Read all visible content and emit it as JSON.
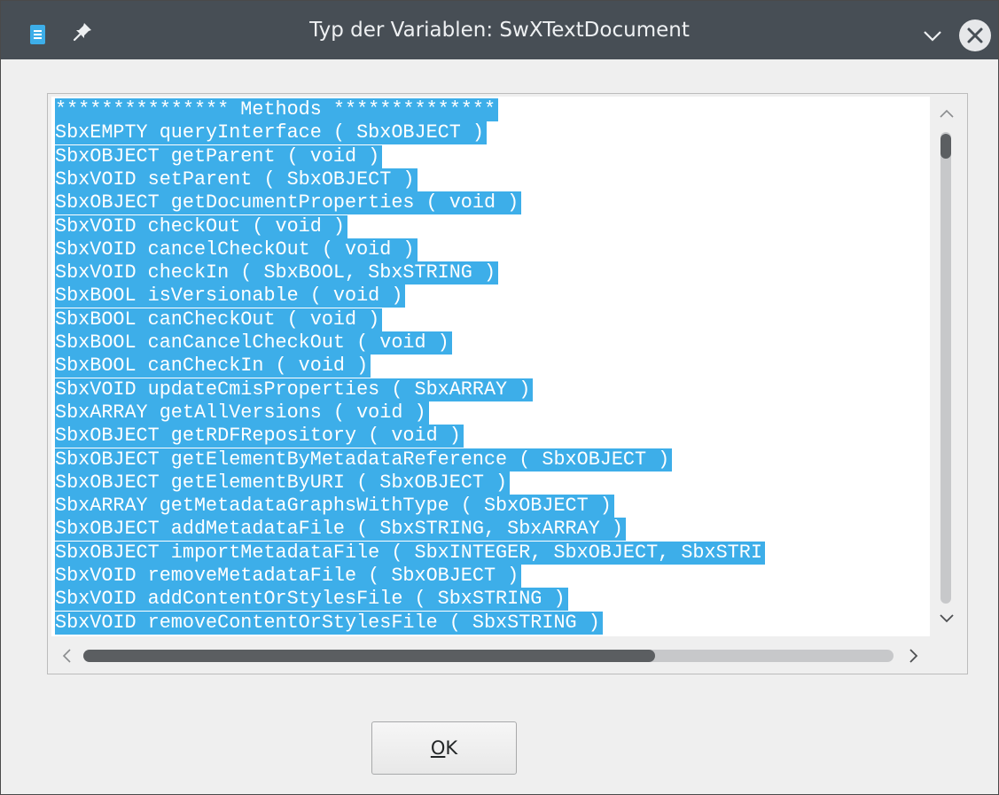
{
  "window": {
    "title": "Typ der Variablen: SwXTextDocument"
  },
  "titlebar_icons": {
    "app": "document-app-icon",
    "pin": "pin-icon",
    "minimize": "chevron-down-icon",
    "close": "close-icon"
  },
  "text_area": {
    "lines": [
      "*************** Methods **************",
      "SbxEMPTY queryInterface ( SbxOBJECT )",
      "SbxOBJECT getParent ( void )",
      "SbxVOID setParent ( SbxOBJECT )",
      "SbxOBJECT getDocumentProperties ( void )",
      "SbxVOID checkOut ( void )",
      "SbxVOID cancelCheckOut ( void )",
      "SbxVOID checkIn ( SbxBOOL, SbxSTRING )",
      "SbxBOOL isVersionable ( void )",
      "SbxBOOL canCheckOut ( void )",
      "SbxBOOL canCancelCheckOut ( void )",
      "SbxBOOL canCheckIn ( void )",
      "SbxVOID updateCmisProperties ( SbxARRAY )",
      "SbxARRAY getAllVersions ( void )",
      "SbxOBJECT getRDFRepository ( void )",
      "SbxOBJECT getElementByMetadataReference ( SbxOBJECT )",
      "SbxOBJECT getElementByURI ( SbxOBJECT )",
      "SbxARRAY getMetadataGraphsWithType ( SbxOBJECT )",
      "SbxOBJECT addMetadataFile ( SbxSTRING, SbxARRAY )",
      "SbxOBJECT importMetadataFile ( SbxINTEGER, SbxOBJECT, SbxSTRI",
      "SbxVOID removeMetadataFile ( SbxOBJECT )",
      "SbxVOID addContentOrStylesFile ( SbxSTRING )",
      "SbxVOID removeContentOrStylesFile ( SbxSTRING )"
    ],
    "selection_color": "#3daee9"
  },
  "scrollbars": {
    "vertical_position": 0.0,
    "horizontal_visible_fraction": 0.7
  },
  "buttons": {
    "ok_mnemonic": "O",
    "ok_rest": "K"
  }
}
